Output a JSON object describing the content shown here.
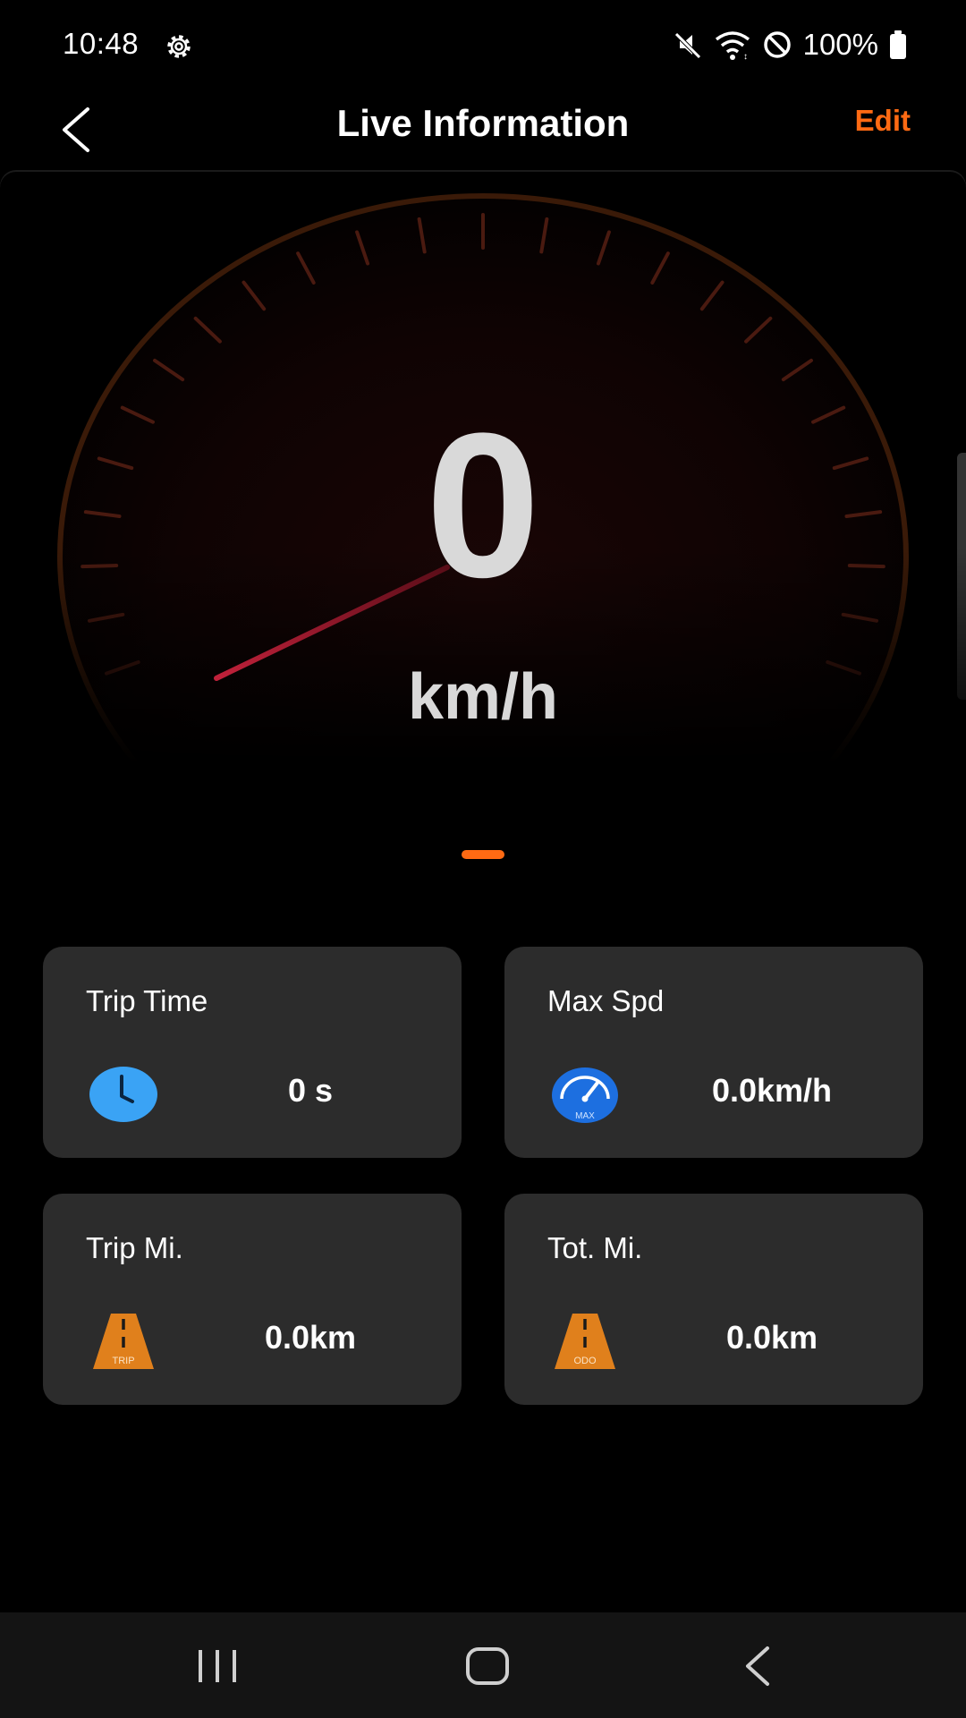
{
  "status_bar": {
    "time": "10:48",
    "battery": "100%",
    "icons": [
      "settings-icon",
      "mute-icon",
      "wifi-icon",
      "do-not-disturb-icon",
      "battery-icon"
    ]
  },
  "header": {
    "title": "Live Information",
    "edit_label": "Edit",
    "back_icon": "chevron-left-icon"
  },
  "speedometer": {
    "value": "0",
    "unit": "km/h"
  },
  "cards": [
    {
      "title": "Trip Time",
      "value": "0 s",
      "icon": "clock-icon"
    },
    {
      "title": "Max Spd",
      "value": "0.0km/h",
      "icon": "max-speed-gauge-icon",
      "icon_text": "MAX"
    },
    {
      "title": "Trip Mi.",
      "value": "0.0km",
      "icon": "road-trip-icon",
      "icon_text": "TRIP"
    },
    {
      "title": "Tot. Mi.",
      "value": "0.0km",
      "icon": "road-odo-icon",
      "icon_text": "ODO"
    }
  ],
  "nav_bar": {
    "icons": [
      "recent-apps-icon",
      "home-icon",
      "back-icon"
    ]
  },
  "colors": {
    "accent": "#ff6a13",
    "card_bg": "#2c2c2c",
    "clock_blue": "#3aa3f5",
    "gauge_blue": "#1d6fe0",
    "road_orange": "#e0801c",
    "needle_red": "#c0213a"
  }
}
